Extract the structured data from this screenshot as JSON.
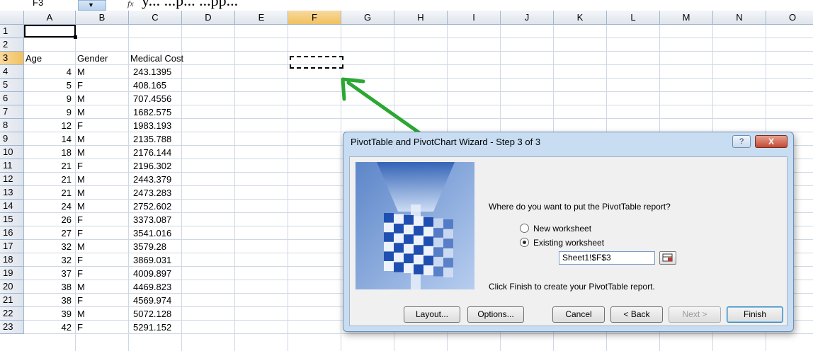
{
  "toolbar": {
    "name_box": "F3",
    "fx_label": "fx",
    "bleed_text": "y... ...p... ...pp..."
  },
  "columns": [
    "A",
    "B",
    "C",
    "D",
    "E",
    "F",
    "G",
    "H",
    "I",
    "J",
    "K",
    "L",
    "M",
    "N",
    "O"
  ],
  "rows": [
    "1",
    "2",
    "3",
    "4",
    "5",
    "6",
    "7",
    "8",
    "9",
    "10",
    "11",
    "12",
    "13",
    "14",
    "15",
    "16",
    "17",
    "18",
    "19",
    "20",
    "21",
    "22",
    "23"
  ],
  "sheet": {
    "headers": {
      "age": "Age",
      "gender": "Gender",
      "cost": "Medical Cost"
    },
    "records": [
      {
        "age": "4",
        "gender": "M",
        "cost": "243.1395"
      },
      {
        "age": "5",
        "gender": "F",
        "cost": "408.165"
      },
      {
        "age": "9",
        "gender": "M",
        "cost": "707.4556"
      },
      {
        "age": "9",
        "gender": "M",
        "cost": "1682.575"
      },
      {
        "age": "12",
        "gender": "F",
        "cost": "1983.193"
      },
      {
        "age": "14",
        "gender": "M",
        "cost": "2135.788"
      },
      {
        "age": "18",
        "gender": "M",
        "cost": "2176.144"
      },
      {
        "age": "21",
        "gender": "F",
        "cost": "2196.302"
      },
      {
        "age": "21",
        "gender": "M",
        "cost": "2443.379"
      },
      {
        "age": "21",
        "gender": "M",
        "cost": "2473.283"
      },
      {
        "age": "24",
        "gender": "M",
        "cost": "2752.602"
      },
      {
        "age": "26",
        "gender": "F",
        "cost": "3373.087"
      },
      {
        "age": "27",
        "gender": "F",
        "cost": "3541.016"
      },
      {
        "age": "32",
        "gender": "M",
        "cost": "3579.28"
      },
      {
        "age": "32",
        "gender": "F",
        "cost": "3869.031"
      },
      {
        "age": "37",
        "gender": "F",
        "cost": "4009.897"
      },
      {
        "age": "38",
        "gender": "M",
        "cost": "4469.823"
      },
      {
        "age": "38",
        "gender": "F",
        "cost": "4569.974"
      },
      {
        "age": "39",
        "gender": "M",
        "cost": "5072.128"
      },
      {
        "age": "42",
        "gender": "F",
        "cost": "5291.152"
      }
    ]
  },
  "dialog": {
    "title": "PivotTable and PivotChart Wizard - Step 3 of 3",
    "help_label": "?",
    "close_label": "X",
    "prompt": "Where do you want to put the PivotTable report?",
    "option_new": "New worksheet",
    "option_existing": "Existing worksheet",
    "reference_value": "Sheet1!$F$3",
    "hint": "Click Finish to create your PivotTable report.",
    "buttons": {
      "layout": "Layout...",
      "options": "Options...",
      "cancel": "Cancel",
      "back": "< Back",
      "next": "Next >",
      "finish": "Finish"
    }
  },
  "colors": {
    "arrow": "#2aa832",
    "header_selected": "#f1c15f",
    "dialog_frame": "#c8ddf2"
  }
}
